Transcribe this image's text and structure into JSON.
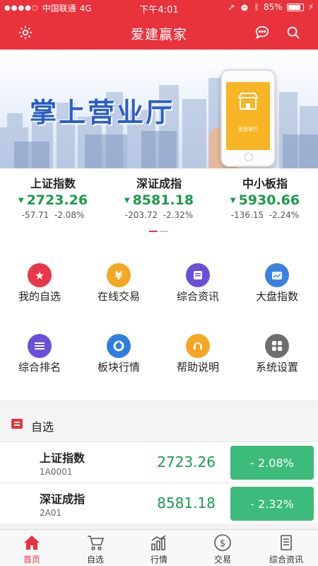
{
  "status_bar": {
    "carrier": "中国联通",
    "network": "4G",
    "time": "下午4:01",
    "battery": "85%",
    "battery_level": 0.85
  },
  "header": {
    "title": "爱建赢家",
    "left_icon": "gear-icon",
    "right_icons": [
      "message-icon",
      "search-icon"
    ]
  },
  "banner": {
    "slogan": "掌上营业厅",
    "phone_label": "爱建掌厅"
  },
  "indices": [
    {
      "name": "上证指数",
      "value": "2723.26",
      "change": "-57.71",
      "percent": "-2.08%"
    },
    {
      "name": "深证成指",
      "value": "8581.18",
      "change": "-203.72",
      "percent": "-2.32%"
    },
    {
      "name": "中小板指",
      "value": "5930.66",
      "change": "-136.15",
      "percent": "-2.24%"
    }
  ],
  "menu": [
    {
      "label": "我的自选",
      "icon": "star-icon",
      "color": "#e8374a"
    },
    {
      "label": "在线交易",
      "icon": "yen-icon",
      "color": "#f5a623"
    },
    {
      "label": "综合资讯",
      "icon": "news-icon",
      "color": "#6b4fd8"
    },
    {
      "label": "大盘指数",
      "icon": "trend-chart-icon",
      "color": "#3b82e0"
    },
    {
      "label": "综合排名",
      "icon": "list-icon",
      "color": "#6b4fd8"
    },
    {
      "label": "板块行情",
      "icon": "pie-chart-icon",
      "color": "#2f7de1"
    },
    {
      "label": "帮助说明",
      "icon": "help-icon",
      "color": "#f5a623"
    },
    {
      "label": "系统设置",
      "icon": "settings-grid-icon",
      "color": "#6e6e6e"
    }
  ],
  "watchlist": {
    "title": "自选",
    "rows": [
      {
        "name": "上证指数",
        "code": "1A0001",
        "price": "2723.26",
        "percent": "- 2.08%"
      },
      {
        "name": "深证成指",
        "code": "2A01",
        "price": "8581.18",
        "percent": "- 2.32%"
      }
    ]
  },
  "tabs": [
    {
      "label": "首页",
      "icon": "home-icon",
      "active": true
    },
    {
      "label": "自选",
      "icon": "cart-icon",
      "active": false
    },
    {
      "label": "行情",
      "icon": "bar-chart-icon",
      "active": false
    },
    {
      "label": "交易",
      "icon": "dollar-icon",
      "active": false
    },
    {
      "label": "综合资讯",
      "icon": "document-icon",
      "active": false
    }
  ],
  "colors": {
    "brand": "#e8323c",
    "down": "#1a9c4a",
    "down_badge": "#3dbb7a"
  }
}
